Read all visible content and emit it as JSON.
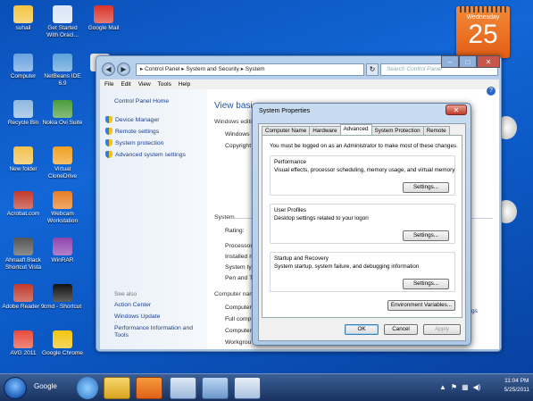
{
  "desktop_icons": [
    {
      "label": "suhail",
      "color": "#f4c542"
    },
    {
      "label": "Get Started With Oracl...",
      "color": "#d9e6f6"
    },
    {
      "label": "Google Mail",
      "color": "#d9342b"
    },
    {
      "label": "Computer",
      "color": "#6aa2e0"
    },
    {
      "label": "NetBeans IDE 6.9",
      "color": "#5da1d8"
    },
    {
      "label": "My",
      "color": "#e8e8e8"
    },
    {
      "label": "Recycle Bin",
      "color": "#8fb8e0"
    },
    {
      "label": "Nokia Ovi Suite",
      "color": "#4b9c3a"
    },
    {
      "label": "New folder",
      "color": "#f2c14e"
    },
    {
      "label": "Virtual CloneDrive",
      "color": "#f0a020"
    },
    {
      "label": "Acrobat.com",
      "color": "#c0392b"
    },
    {
      "label": "Webcam Workstation",
      "color": "#e67e22"
    },
    {
      "label": "Ahnaaft Black Shortcut Vista",
      "color": "#555555"
    },
    {
      "label": "WinRAR",
      "color": "#8e44ad"
    },
    {
      "label": "Adobe Reader 9",
      "color": "#c0392b"
    },
    {
      "label": "cmd - Shortcut",
      "color": "#111111"
    },
    {
      "label": "AVG 2011",
      "color": "#e74c3c"
    },
    {
      "label": "Google Chrome",
      "color": "#f1c40f"
    }
  ],
  "calendar": {
    "day": "Wednesday",
    "date": "25"
  },
  "control_panel": {
    "back": "◀",
    "forward": "▶",
    "address": "▸ Control Panel ▸ System and Security ▸ System",
    "refresh": "↻",
    "search_placeholder": "Search Control Panel",
    "menu": [
      "File",
      "Edit",
      "View",
      "Tools",
      "Help"
    ],
    "home": "Control Panel Home",
    "tasks": [
      "Device Manager",
      "Remote settings",
      "System protection",
      "Advanced system settings"
    ],
    "see_also": "See also",
    "see_also_links": [
      "Action Center",
      "Windows Update",
      "Performance Information and Tools"
    ],
    "heading": "View basic",
    "windows_edition": "Windows editi",
    "windows7": "Windows 7",
    "copyright": "Copyright",
    "system_section": "System",
    "system_rows": [
      "Rating:",
      "Processor",
      "Installed m",
      "System typ",
      "Pen and To"
    ],
    "computer_section": "Computer nam",
    "computer_rows": [
      "Computer",
      "Full compu",
      "Computer",
      "Workgrou"
    ],
    "change_link": "gs",
    "help": "?"
  },
  "system_properties": {
    "title": "System Properties",
    "close": "✕",
    "tabs": [
      "Computer Name",
      "Hardware",
      "Advanced",
      "System Protection",
      "Remote"
    ],
    "active_tab": "Advanced",
    "notice": "You must be logged on as an Administrator to make most of these changes.",
    "groups": [
      {
        "title": "Performance",
        "desc": "Visual effects, processor scheduling, memory usage, and virtual memory",
        "button": "Settings..."
      },
      {
        "title": "User Profiles",
        "desc": "Desktop settings related to your logon",
        "button": "Settings..."
      },
      {
        "title": "Startup and Recovery",
        "desc": "System startup, system failure, and debugging information",
        "button": "Settings..."
      }
    ],
    "env_button": "Environment Variables...",
    "ok": "OK",
    "cancel": "Cancel",
    "apply": "Apply"
  },
  "taskbar": {
    "google_label": "Google",
    "clock_time": "11:04 PM",
    "clock_date": "5/25/2011"
  }
}
